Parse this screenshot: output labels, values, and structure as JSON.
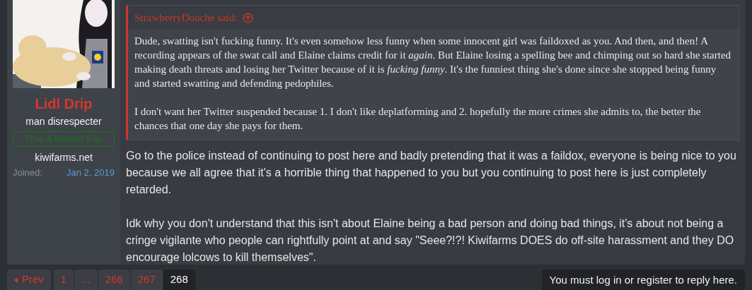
{
  "user": {
    "name": "Lidl Drip",
    "title": "man disrespecter",
    "banner": "True & Honest Fan",
    "site": "kiwifarms.net",
    "joined_label": "Joined:",
    "joined_value": "Jan 2, 2019"
  },
  "quote": {
    "author": "StrawberryDouche said:",
    "paragraphs": [
      "Dude, swatting isn't fucking funny. It's even somehow less funny when some innocent girl was faildoxed as you. And then, and then! A recording appears of the swat call and Elaine claims credit for it *again*. But Elaine losing a spelling bee and chimping out so hard she started making death threats and losing her Twitter because of it is *fucking funny*. It's the funniest thing she's done since she stopped being funny and started swatting and defending pedophiles.",
      "I don't want her Twitter suspended because 1. I don't like deplatforming and 2. hopefully the more crimes she admits to, the better the chances that one day she pays for them."
    ]
  },
  "post": {
    "paragraphs": [
      "Go to the police instead of continuing to post here and badly pretending that it was a faildox, everyone is being nice to you because we all agree that it's a horrible thing that happened to you but you continuing to post here is just completely retarded.",
      "Idk why you don't understand that this isn't about Elaine being a bad person and doing bad things, it's about not being a cringe vigilante who people can rightfully point at and say \"Seee?!?! Kiwifarms DOES do off-site harassment and they DO encourage lolcows to kill themselves\"."
    ]
  },
  "pagination": {
    "prev": "Prev",
    "pages": [
      {
        "label": "1",
        "selected": false
      },
      {
        "label": "...",
        "selected": false
      },
      {
        "label": "266",
        "selected": false
      },
      {
        "label": "267",
        "selected": false
      },
      {
        "label": "268",
        "selected": true
      }
    ]
  },
  "reply_notice": "You must log in or register to reply here."
}
